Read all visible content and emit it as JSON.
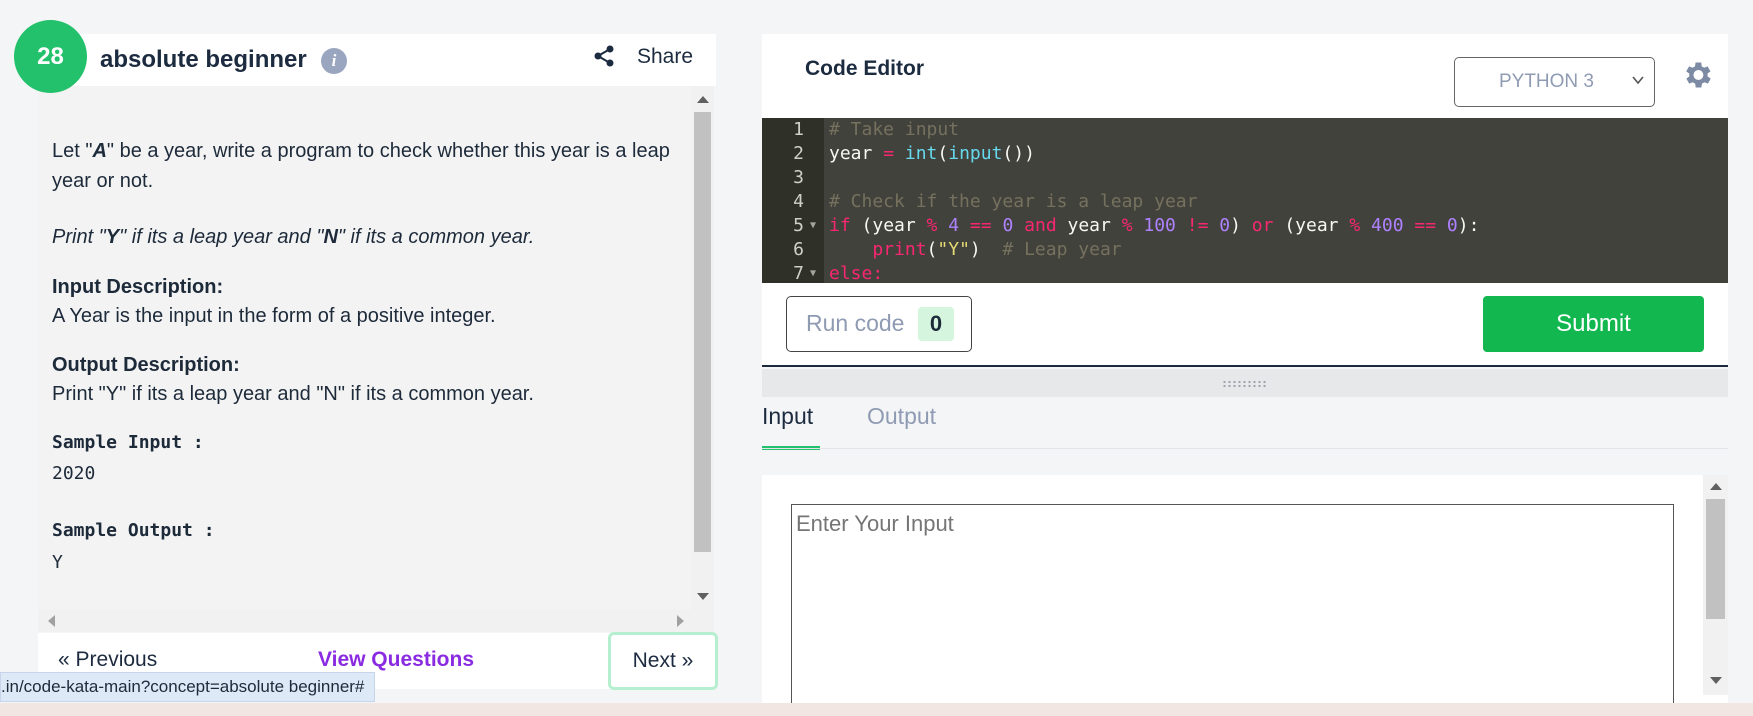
{
  "problem": {
    "level": "28",
    "title": "absolute beginner",
    "share_label": "Share",
    "statement_prefix": "Let \"",
    "statement_var": "A",
    "statement_suffix": "\" be a year, write a program to check whether this year is a leap year or not.",
    "instruction_prefix": "Print \"",
    "instruction_y": "Y",
    "instruction_mid": "\" if its a leap year and \"",
    "instruction_n": "N",
    "instruction_suffix": "\" if its a common year.",
    "input_heading": "Input Description:",
    "input_text": "A Year is the input in the form of a positive integer.",
    "output_heading": "Output Description:",
    "output_text": "Print \"Y\" if its a leap year and \"N\" if its a common year.",
    "sample_input_heading": "Sample Input :",
    "sample_input_value": "2020",
    "sample_output_heading": "Sample Output :",
    "sample_output_value": "Y"
  },
  "nav": {
    "previous_label": "«  Previous",
    "view_questions_label": "View Questions",
    "next_label": "Next  »"
  },
  "status_bar": {
    "url": ".in/code-kata-main?concept=absolute beginner#"
  },
  "editor": {
    "title": "Code Editor",
    "language": "PYTHON 3",
    "code_lines": [
      "# Take input",
      "year = int(input())",
      "",
      "# Check if the year is a leap year",
      "if (year % 4 == 0 and year % 100 != 0) or (year % 400 == 0):",
      "    print(\"Y\")  # Leap year",
      "else:"
    ],
    "line_numbers": [
      "1",
      "2",
      "3",
      "4",
      "5",
      "6",
      "7"
    ],
    "run_label": "Run code",
    "run_count": "0",
    "submit_label": "Submit"
  },
  "io_tabs": {
    "input_label": "Input",
    "output_label": "Output",
    "input_placeholder": "Enter Your Input",
    "active": "Input"
  },
  "colors": {
    "accent_green": "#23c16b",
    "submit_green": "#12b84f",
    "link_purple": "#8a2be2",
    "editor_bg": "#42423c"
  },
  "icons": [
    "info-icon",
    "share-icon",
    "gear-icon",
    "chevron-down-icon"
  ]
}
